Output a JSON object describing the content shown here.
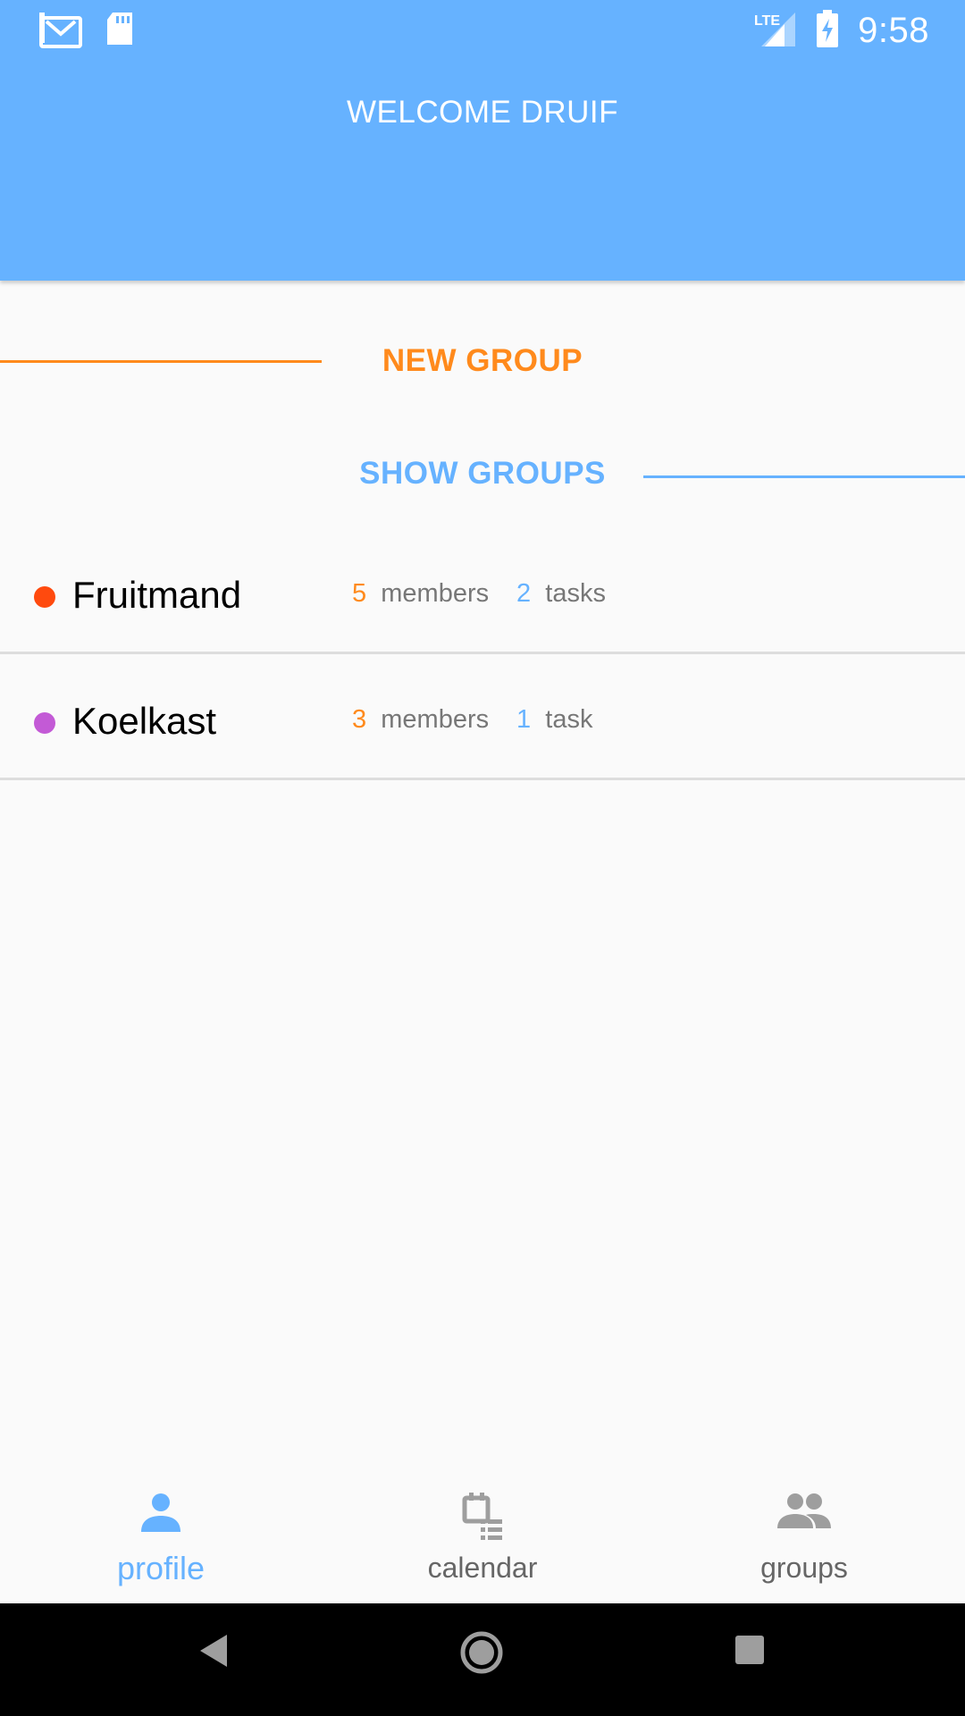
{
  "status_bar": {
    "time": "9:58",
    "network": "LTE",
    "icons": [
      "gmail-icon",
      "sd-card-icon",
      "signal-icon",
      "battery-charging-icon"
    ]
  },
  "header": {
    "title": "WELCOME DRUIF",
    "background": "#66b2ff"
  },
  "tabs": {
    "new_group": "NEW GROUP",
    "show_groups": "SHOW GROUPS"
  },
  "groups": [
    {
      "name": "Fruitmand",
      "color": "#ff4a0e",
      "members_count": "5",
      "members_label": "members",
      "tasks_count": "2",
      "tasks_label": "tasks"
    },
    {
      "name": "Koelkast",
      "color": "#c35ad6",
      "members_count": "3",
      "members_label": "members",
      "tasks_count": "1",
      "tasks_label": "task"
    }
  ],
  "bottom_nav": {
    "profile": "profile",
    "calendar": "calendar",
    "groups": "groups",
    "active": "profile"
  },
  "colors": {
    "accent_orange": "#ff8a1c",
    "accent_blue": "#66b2ff"
  }
}
